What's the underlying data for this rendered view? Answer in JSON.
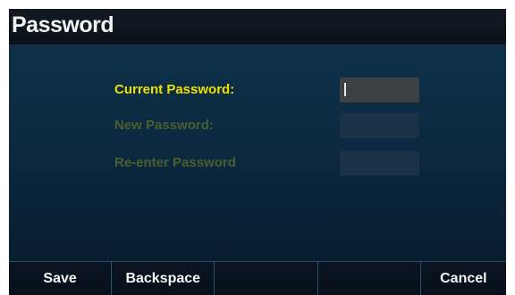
{
  "header": {
    "title": "Password"
  },
  "form": {
    "fields": [
      {
        "label": "Current Password:",
        "value": "",
        "state": "active"
      },
      {
        "label": "New Password:",
        "value": "",
        "state": "inactive"
      },
      {
        "label": "Re-enter Password",
        "value": "",
        "state": "inactive"
      }
    ]
  },
  "softkeys": [
    {
      "label": "Save"
    },
    {
      "label": "Backspace"
    },
    {
      "label": ""
    },
    {
      "label": ""
    },
    {
      "label": "Cancel"
    }
  ],
  "colors": {
    "active_label": "#f0e000",
    "inactive_label": "#4a5f2c",
    "background": "#0b2a41"
  }
}
